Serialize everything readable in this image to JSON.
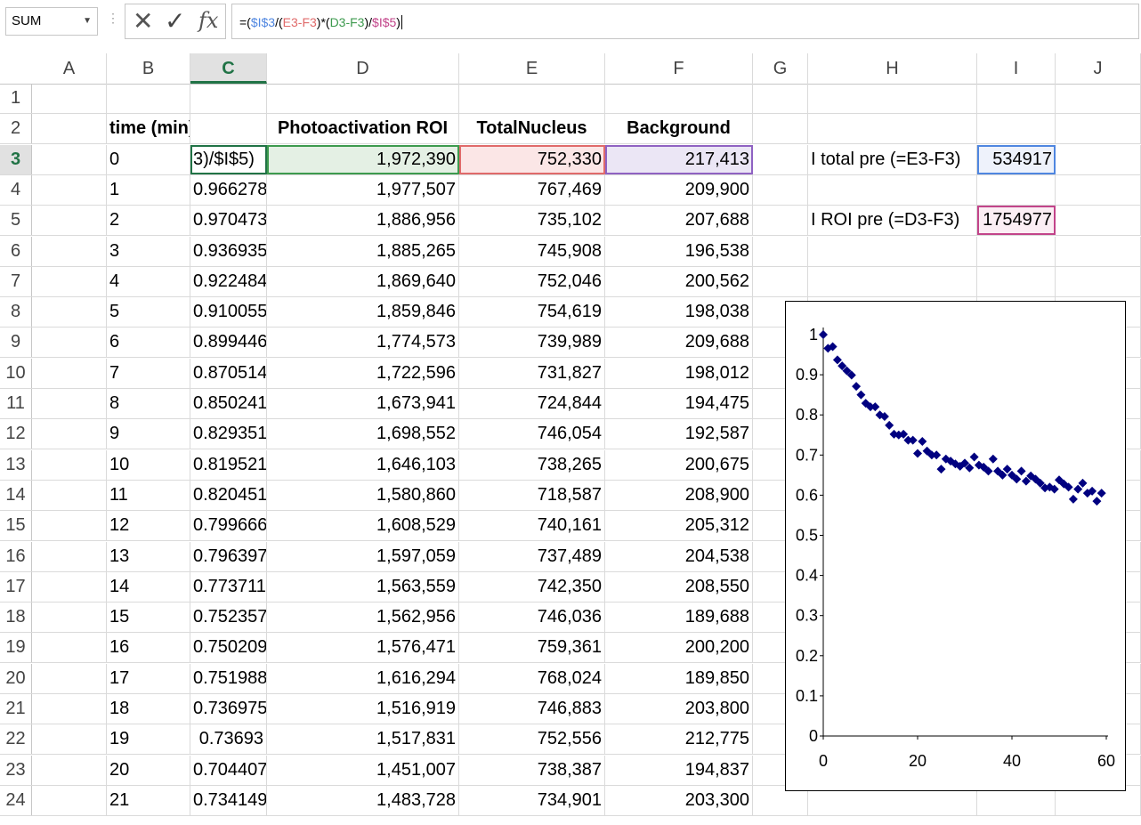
{
  "namebox": {
    "value": "SUM"
  },
  "formula_bar": {
    "parts": [
      {
        "text": "=(",
        "color": "#000000"
      },
      {
        "text": "$I$3",
        "color": "#4f86e0"
      },
      {
        "text": "/(",
        "color": "#000000"
      },
      {
        "text": "E3-F3",
        "color": "#e06a6a"
      },
      {
        "text": ")*(",
        "color": "#000000"
      },
      {
        "text": "D3-F3",
        "color": "#3d9a4e"
      },
      {
        "text": ")/",
        "color": "#000000"
      },
      {
        "text": "$I$5",
        "color": "#c2448a"
      },
      {
        "text": ")",
        "color": "#000000"
      }
    ],
    "cancel_glyph": "✕",
    "enter_glyph": "✓",
    "fx_glyph": "fx"
  },
  "columns": [
    "A",
    "B",
    "C",
    "D",
    "E",
    "F",
    "G",
    "H",
    "I",
    "J"
  ],
  "selected_column": "C",
  "headers_row2": {
    "B": "time (min)",
    "D": "Photoactivation ROI",
    "E": "TotalNucleus",
    "F": "Background"
  },
  "rows": [
    {
      "n": "1"
    },
    {
      "n": "2"
    },
    {
      "n": "3",
      "B": "0",
      "C": "3)/$I$5)",
      "D": "1,972,390",
      "E": "752,330",
      "F": "217,413",
      "H": "I total pre (=E3-F3)",
      "I": "534917"
    },
    {
      "n": "4",
      "B": "1",
      "C": "0.966278",
      "D": "1,977,507",
      "E": "767,469",
      "F": "209,900"
    },
    {
      "n": "5",
      "B": "2",
      "C": "0.970473",
      "D": "1,886,956",
      "E": "735,102",
      "F": "207,688",
      "H": "I ROI pre (=D3-F3)",
      "I": "1754977"
    },
    {
      "n": "6",
      "B": "3",
      "C": "0.936935",
      "D": "1,885,265",
      "E": "745,908",
      "F": "196,538"
    },
    {
      "n": "7",
      "B": "4",
      "C": "0.922484",
      "D": "1,869,640",
      "E": "752,046",
      "F": "200,562"
    },
    {
      "n": "8",
      "B": "5",
      "C": "0.910055",
      "D": "1,859,846",
      "E": "754,619",
      "F": "198,038"
    },
    {
      "n": "9",
      "B": "6",
      "C": "0.899446",
      "D": "1,774,573",
      "E": "739,989",
      "F": "209,688"
    },
    {
      "n": "10",
      "B": "7",
      "C": "0.870514",
      "D": "1,722,596",
      "E": "731,827",
      "F": "198,012"
    },
    {
      "n": "11",
      "B": "8",
      "C": "0.850241",
      "D": "1,673,941",
      "E": "724,844",
      "F": "194,475"
    },
    {
      "n": "12",
      "B": "9",
      "C": "0.829351",
      "D": "1,698,552",
      "E": "746,054",
      "F": "192,587"
    },
    {
      "n": "13",
      "B": "10",
      "C": "0.819521",
      "D": "1,646,103",
      "E": "738,265",
      "F": "200,675"
    },
    {
      "n": "14",
      "B": "11",
      "C": "0.820451",
      "D": "1,580,860",
      "E": "718,587",
      "F": "208,900"
    },
    {
      "n": "15",
      "B": "12",
      "C": "0.799666",
      "D": "1,608,529",
      "E": "740,161",
      "F": "205,312"
    },
    {
      "n": "16",
      "B": "13",
      "C": "0.796397",
      "D": "1,597,059",
      "E": "737,489",
      "F": "204,538"
    },
    {
      "n": "17",
      "B": "14",
      "C": "0.773711",
      "D": "1,563,559",
      "E": "742,350",
      "F": "208,550"
    },
    {
      "n": "18",
      "B": "15",
      "C": "0.752357",
      "D": "1,562,956",
      "E": "746,036",
      "F": "189,688"
    },
    {
      "n": "19",
      "B": "16",
      "C": "0.750209",
      "D": "1,576,471",
      "E": "759,361",
      "F": "200,200"
    },
    {
      "n": "20",
      "B": "17",
      "C": "0.751988",
      "D": "1,616,294",
      "E": "768,024",
      "F": "189,850"
    },
    {
      "n": "21",
      "B": "18",
      "C": "0.736975",
      "D": "1,516,919",
      "E": "746,883",
      "F": "203,800"
    },
    {
      "n": "22",
      "B": "19",
      "C": "0.73693",
      "D": "1,517,831",
      "E": "752,556",
      "F": "212,775"
    },
    {
      "n": "23",
      "B": "20",
      "C": "0.704407",
      "D": "1,451,007",
      "E": "738,387",
      "F": "194,837"
    },
    {
      "n": "24",
      "B": "21",
      "C": "0.734149",
      "D": "1,483,728",
      "E": "734,901",
      "F": "203,300"
    }
  ],
  "chart_data": {
    "type": "scatter",
    "marker": "diamond",
    "marker_color": "#000080",
    "xlim": [
      0,
      60
    ],
    "ylim": [
      0,
      1
    ],
    "x_ticks": [
      "0",
      "20",
      "40",
      "60"
    ],
    "y_ticks": [
      "0",
      "0.1",
      "0.2",
      "0.3",
      "0.4",
      "0.5",
      "0.6",
      "0.7",
      "0.8",
      "0.9",
      "1"
    ],
    "grid": false,
    "x": [
      0,
      1,
      2,
      3,
      4,
      5,
      6,
      7,
      8,
      9,
      10,
      11,
      12,
      13,
      14,
      15,
      16,
      17,
      18,
      19,
      20,
      21,
      22,
      23,
      24,
      25,
      26,
      27,
      28,
      29,
      30,
      31,
      32,
      33,
      34,
      35,
      36,
      37,
      38,
      39,
      40,
      41,
      42,
      43,
      44,
      45,
      46,
      47,
      48,
      49,
      50,
      51,
      52,
      53,
      54,
      55,
      56,
      57,
      58,
      59
    ],
    "y": [
      1.0,
      0.966,
      0.97,
      0.937,
      0.922,
      0.91,
      0.899,
      0.871,
      0.85,
      0.829,
      0.82,
      0.82,
      0.8,
      0.796,
      0.774,
      0.752,
      0.75,
      0.752,
      0.737,
      0.737,
      0.704,
      0.734,
      0.71,
      0.7,
      0.7,
      0.665,
      0.69,
      0.685,
      0.678,
      0.672,
      0.68,
      0.668,
      0.695,
      0.675,
      0.67,
      0.66,
      0.69,
      0.66,
      0.65,
      0.665,
      0.65,
      0.64,
      0.66,
      0.635,
      0.648,
      0.64,
      0.63,
      0.618,
      0.62,
      0.615,
      0.638,
      0.628,
      0.62,
      0.59,
      0.615,
      0.63,
      0.605,
      0.61,
      0.585,
      0.605
    ]
  }
}
